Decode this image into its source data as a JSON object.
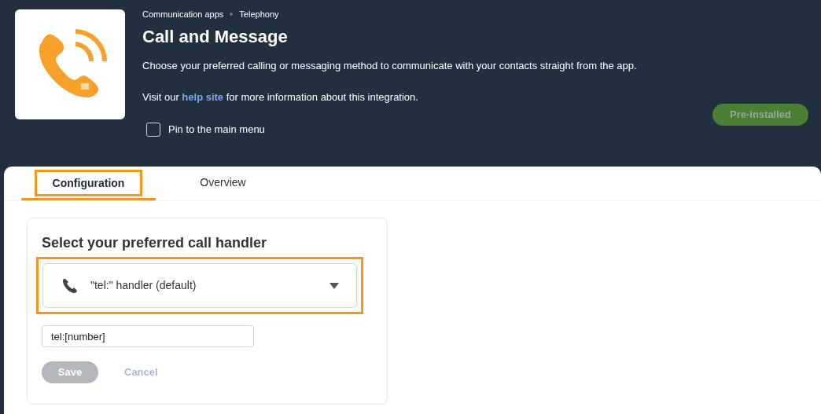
{
  "breadcrumbs": [
    "Communication apps",
    "Telephony"
  ],
  "app": {
    "title": "Call and Message",
    "description": "Choose your preferred calling or messaging method to communicate with your contacts straight from the app.",
    "help_text": "Visit our **help site** for more information about this integration.",
    "pin": {
      "label": "Pin to the main menu",
      "checked": false
    },
    "status_button": {
      "label": "Pre-installed",
      "disabled": true
    }
  },
  "tabs": [
    {
      "label": "Configuration",
      "selected": true,
      "highlighted": true
    },
    {
      "label": "Overview",
      "selected": false,
      "highlighted": false
    }
  ],
  "config": {
    "heading": "Select your preferred call handler",
    "handler": {
      "value": "\"tel:\" handler (default)",
      "highlighted": true
    },
    "url_field": {
      "value": "tel:[number]"
    },
    "save": {
      "label": "Save",
      "disabled": true
    },
    "cancel": {
      "label": "Cancel",
      "disabled": true
    }
  }
}
